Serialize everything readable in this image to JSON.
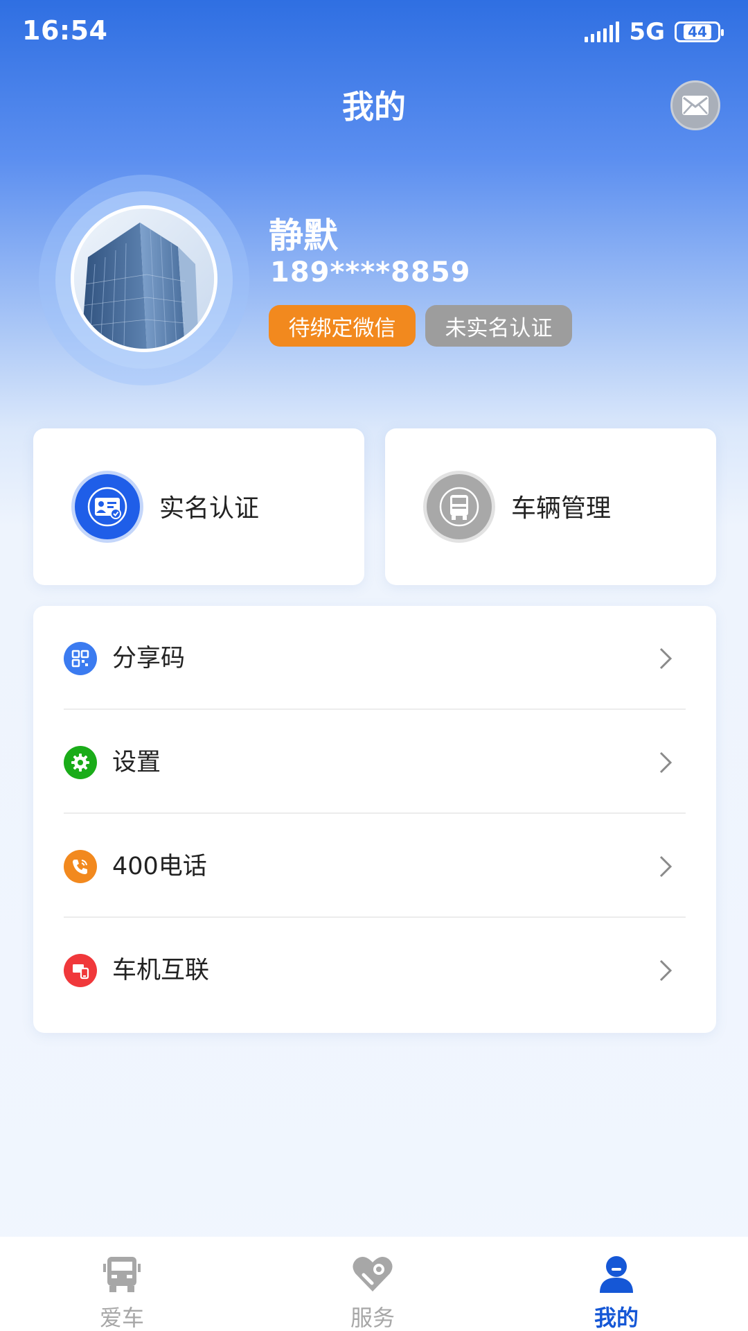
{
  "status_bar": {
    "time": "16:54",
    "network": "5G",
    "battery": "44"
  },
  "header": {
    "title": "我的",
    "message_icon": "envelope-icon"
  },
  "profile": {
    "name": "静默",
    "phone": "189****8859",
    "tags": [
      "待绑定微信",
      "未实名认证"
    ]
  },
  "cards": [
    {
      "label": "实名认证",
      "icon": "id-card-icon",
      "color": "#1f5ee8"
    },
    {
      "label": "车辆管理",
      "icon": "truck-icon",
      "color": "#a8a8a8"
    }
  ],
  "menu": [
    {
      "label": "分享码",
      "icon": "qr-code-icon",
      "color": "#3b7bf0"
    },
    {
      "label": "设置",
      "icon": "gear-icon",
      "color": "#1aac19"
    },
    {
      "label": "400电话",
      "icon": "phone-icon",
      "color": "#f2891e"
    },
    {
      "label": "车机互联",
      "icon": "device-link-icon",
      "color": "#f0383b"
    }
  ],
  "tabs": [
    {
      "label": "爱车",
      "icon": "truck-icon",
      "active": false
    },
    {
      "label": "服务",
      "icon": "heart-wrench-icon",
      "active": false
    },
    {
      "label": "我的",
      "icon": "user-icon",
      "active": true
    }
  ],
  "colors": {
    "accent": "#1557d6",
    "header_blue": "#2f6fe2",
    "tag_orange": "#f2891e",
    "tag_gray": "#9d9d9d",
    "inactive": "#a7a7a7"
  }
}
